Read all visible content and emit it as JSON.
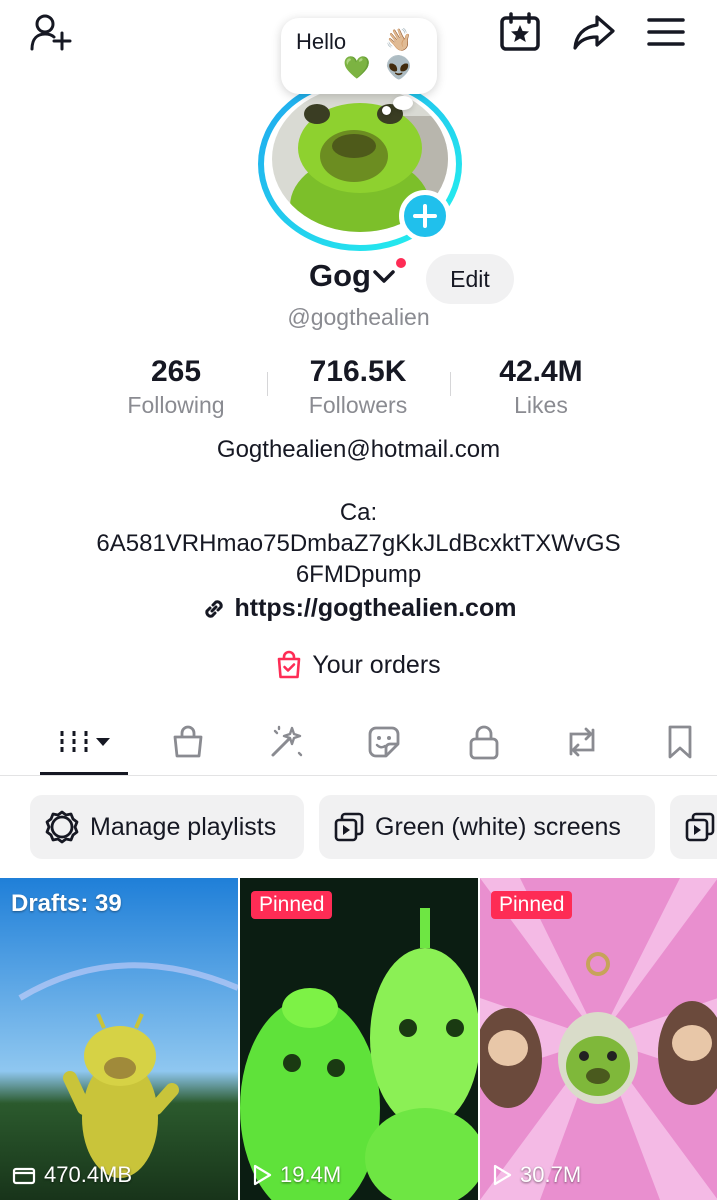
{
  "topbar": {
    "add_friend_icon": "person-plus-icon",
    "calendar_icon": "calendar-star-icon",
    "share_icon": "share-arrow-icon",
    "menu_icon": "hamburger-menu-icon"
  },
  "bubble": {
    "text": "Hello",
    "emoji": "👋🏼👽",
    "heart": "💚"
  },
  "profile": {
    "name": "Gog",
    "handle": "@gogthealien",
    "edit_label": "Edit"
  },
  "stats": [
    {
      "value": "265",
      "label": "Following"
    },
    {
      "value": "716.5K",
      "label": "Followers"
    },
    {
      "value": "42.4M",
      "label": "Likes"
    }
  ],
  "bio": {
    "email": "Gogthealien@hotmail.com",
    "ca_label": "Ca:",
    "ca_line1": "6A581VRHmao75DmbaZ7gKkJLdBcxktTXWvGS",
    "ca_line2": "6FMDpump",
    "link": "https://gogthealien.com",
    "orders": "Your orders"
  },
  "tabs": [
    "videos-grid-icon",
    "shop-bag-icon",
    "magic-wand-icon",
    "sticker-icon",
    "lock-icon",
    "repost-icon",
    "bookmark-icon"
  ],
  "chips": {
    "manage": "Manage playlists",
    "green": "Green (white) screens"
  },
  "videos": [
    {
      "badge": "Drafts: 39",
      "stat": "470.4MB"
    },
    {
      "badge": "Pinned",
      "stat": "19.4M"
    },
    {
      "badge": "Pinned",
      "stat": "30.7M"
    }
  ],
  "colors": {
    "accent": "#fe2c55",
    "ring": "#20d5ec",
    "badge_blue": "#20c0ec"
  }
}
